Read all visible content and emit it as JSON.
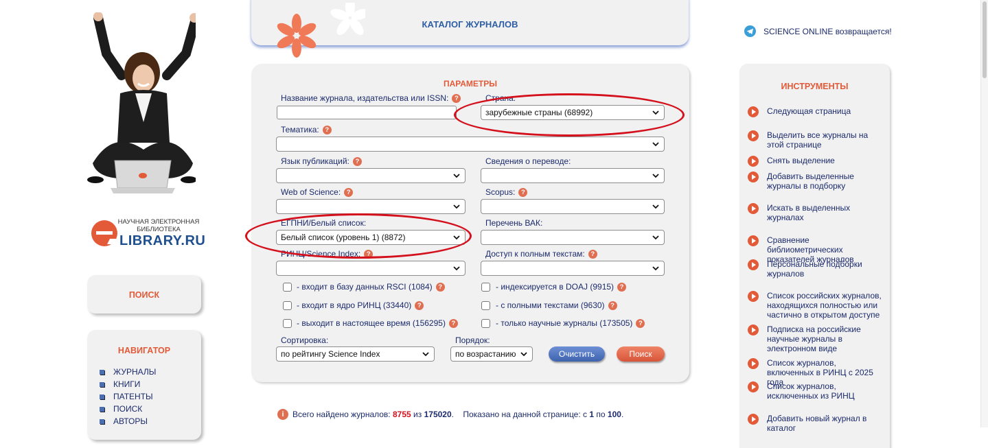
{
  "logo": {
    "small_text": "НАУЧНАЯ ЭЛЕКТРОННАЯ БИБЛИОТЕКА",
    "big_text": "LIBRARY.RU"
  },
  "left": {
    "search_title": "ПОИСК",
    "navigator_title": "НАВИГАТОР",
    "nav_items": [
      "ЖУРНАЛЫ",
      "КНИГИ",
      "ПАТЕНТЫ",
      "ПОИСК",
      "АВТОРЫ"
    ]
  },
  "header": {
    "title": "КАТАЛОГ ЖУРНАЛОВ"
  },
  "params": {
    "title": "ПАРАМЕТРЫ",
    "journal_name_label": "Название журнала, издательства или ISSN:",
    "journal_name_value": "",
    "country_label": "Страна:",
    "country_value": "зарубежные страны  (68992)",
    "topic_label": "Тематика:",
    "topic_value": "",
    "language_label": "Язык публикаций:",
    "language_value": "",
    "translation_label": "Сведения о переводе:",
    "translation_value": "",
    "wos_label": "Web of Science:",
    "wos_value": "",
    "scopus_label": "Scopus:",
    "scopus_value": "",
    "egpni_label": "ЕГПНИ/Белый список:",
    "egpni_value": "Белый список (уровень 1)  (8872)",
    "vak_label": "Перечень ВАК:",
    "vak_value": "",
    "rinc_label": "РИНЦ/Science Index:",
    "rinc_value": "",
    "fulltext_label": "Доступ к полным текстам:",
    "fulltext_value": "",
    "checkboxes": [
      {
        "label": "- входит в базу данных RSCI (1084)",
        "checked": false
      },
      {
        "label": "- индексируется в DOAJ (9915)",
        "checked": false
      },
      {
        "label": "- входит в ядро РИНЦ (33440)",
        "checked": false
      },
      {
        "label": "- с полными текстами (9630)",
        "checked": false
      },
      {
        "label": "- выходит в настоящее время (156295)",
        "checked": false
      },
      {
        "label": "- только научные журналы (173505)",
        "checked": false
      }
    ],
    "sort_label": "Сортировка:",
    "sort_value": "по рейтингу Science Index",
    "order_label": "Порядок:",
    "order_value": "по возрастанию",
    "clear_button": "Очистить",
    "search_button": "Поиск"
  },
  "results": {
    "prefix": "Всего найдено журналов:",
    "found": "8755",
    "of": "из",
    "total": "175020",
    "shown_text": "Показано на данной странице: с",
    "from": "1",
    "to_word": "по",
    "to": "100",
    "end": "."
  },
  "right": {
    "telegram_text": "SCIENCE ONLINE возвращается!",
    "tools_title": "ИНСТРУМЕНТЫ",
    "tools": [
      "Следующая страница",
      "Выделить все журналы на этой странице",
      "Снять выделение",
      "Добавить выделенные журналы в подборку",
      "Искать в выделенных журналах",
      "Сравнение библиометрических показателей журналов",
      "Персональные подборки журналов",
      "Список российских журналов, находящихся полностью или частично в открытом доступе",
      "Подписка на российские научные журналы в электронном виде",
      "Список журналов, включенных в РИНЦ с 2025 года",
      "Список журналов, исключенных из РИНЦ",
      "Добавить новый журнал в каталог"
    ]
  },
  "colors": {
    "accent": "#e25a38",
    "link": "#1b2a6b",
    "highlight_oval": "#d4101c",
    "clear_button": "#4a6db4"
  }
}
